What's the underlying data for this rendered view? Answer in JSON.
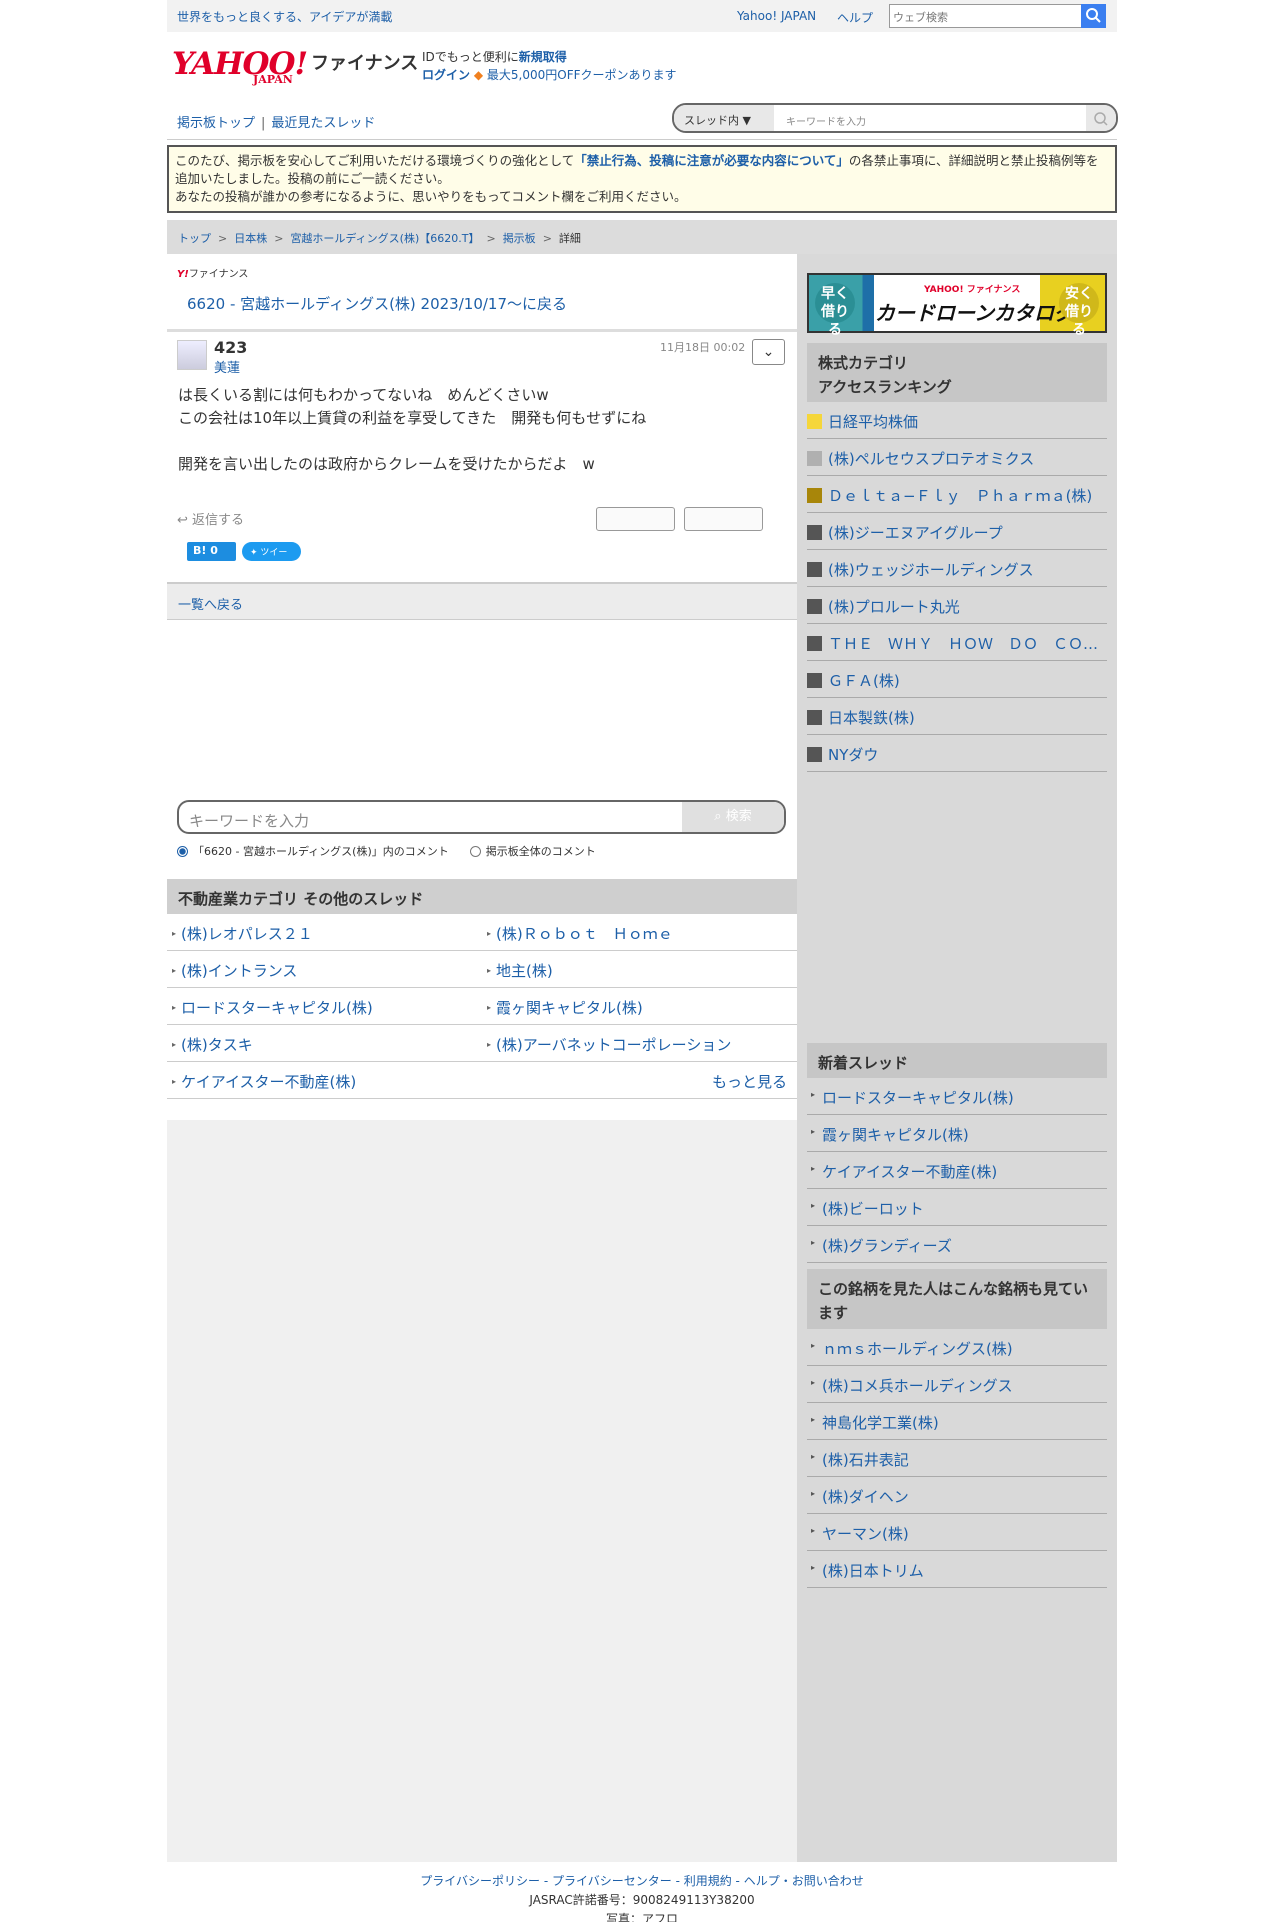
{
  "topbar": {
    "tagline": "世界をもっと良くする、アイデアが満載",
    "yahoo_japan": "Yahoo! JAPAN",
    "help": "ヘルプ",
    "search_placeholder": "ウェブ検索"
  },
  "header": {
    "logo": "YAHOO!",
    "logo_sub": "JAPAN",
    "product": "ファイナンス",
    "id_text": "IDでもっと便利に",
    "signup": "新規取得",
    "login": "ログイン",
    "coupon": "最大5,000円OFFクーポンあります"
  },
  "board_nav": {
    "top": "掲示板トップ",
    "sep": "|",
    "recent": "最近見たスレッド",
    "scope": "スレッド内",
    "search_placeholder": "キーワードを入力"
  },
  "notice": {
    "line1_pre": "このたび、掲示板を安心してご利用いただける環境づくりの強化として",
    "line1_link": "「禁止行為、投稿に注意が必要な内容について」",
    "line1_post": "の各禁止事項に、詳細説明と禁止投稿例等を追加いたしました。投稿の前にご一読ください。",
    "line2": "あなたの投稿が誰かの参考になるように、思いやりをもってコメント欄をご利用ください。"
  },
  "breadcrumb": [
    "トップ",
    "日本株",
    "宮越ホールディングス(株)【6620.T】",
    "掲示板",
    "詳細"
  ],
  "post": {
    "brand_small": "ファイナンス",
    "back_thread": "6620 - 宮越ホールディングス(株) 2023/10/17〜に戻る",
    "number": "423",
    "author": "美蓮",
    "date": "11月18日 00:02",
    "menu_icon": "chevron-down-icon",
    "body": "​​は長くいる割には何もわかってないね　めんどくさいw\nこの会社は10年以上賃貸の利益を享受してきた　開発も何もせずにね\n\n開発を言い出したのは政府からクレームを受けたからだよ　w",
    "reply": "返信する",
    "hatena": "B! 0",
    "tweet": "ツイート"
  },
  "back_list": "一覧へ戻る",
  "keyword_search": {
    "placeholder": "キーワードを入力",
    "button": "検索",
    "option_thread": "「6620 - 宮越ホールディングス(株)」内のコメント",
    "option_all": "掲示板全体のコメント"
  },
  "other_threads": {
    "title": "不動産業カテゴリ  その他のスレッド",
    "items": [
      [
        "(株)レオパレス２１",
        "(株)Ｒｏｂｏｔ　Ｈｏｍｅ"
      ],
      [
        "(株)イントランス",
        "地主(株)"
      ],
      [
        "ロードスターキャピタル(株)",
        "霞ヶ関キャピタル(株)"
      ],
      [
        "(株)タスキ",
        "(株)アーバネットコーポレーション"
      ]
    ],
    "last": "ケイアイスター不動産(株)",
    "more": "もっと見る"
  },
  "banner": {
    "left": "早く借りる",
    "right": "安く借りる",
    "text": "カードローンカタログ",
    "brand": "YAHOO! ファイナンス"
  },
  "ranking": {
    "title_line1": "株式カテゴリ",
    "title_line2": "アクセスランキング",
    "items": [
      {
        "label": "日経平均株価",
        "color": "#f5d63a"
      },
      {
        "label": "(株)ペルセウスプロテオミクス",
        "color": "#b0b0b0"
      },
      {
        "label": "Ｄｅｌｔａ−Ｆｌｙ　Ｐｈａｒｍａ(株)",
        "color": "#a8860a"
      },
      {
        "label": "(株)ジーエヌアイグループ",
        "color": "#555555"
      },
      {
        "label": "(株)ウェッジホールディングス",
        "color": "#555555"
      },
      {
        "label": "(株)プロルート丸光",
        "color": "#555555"
      },
      {
        "label": "ＴＨＥ　ＷＨＹ　ＨＯＷ　ＤＯ　ＣＯＭＰＡＮＹ(株)",
        "color": "#555555"
      },
      {
        "label": "ＧＦＡ(株)",
        "color": "#555555"
      },
      {
        "label": "日本製鉄(株)",
        "color": "#555555"
      },
      {
        "label": "NYダウ",
        "color": "#555555"
      }
    ]
  },
  "new_threads": {
    "title": "新着スレッド",
    "items": [
      "ロードスターキャピタル(株)",
      "霞ヶ関キャピタル(株)",
      "ケイアイスター不動産(株)",
      "(株)ビーロット",
      "(株)グランディーズ"
    ]
  },
  "also_viewed": {
    "title": "この銘柄を見た人はこんな銘柄も見ています",
    "items": [
      "ｎｍｓホールディングス(株)",
      "(株)コメ兵ホールディングス",
      "神島化学工業(株)",
      "(株)石井表記",
      "(株)ダイヘン",
      "ヤーマン(株)",
      "(株)日本トリム"
    ]
  },
  "footer": {
    "links": "プライバシーポリシー - プライバシーセンター - 利用規約 - ヘルプ・お問い合わせ",
    "jasrac": "JASRAC許諾番号：9008249113Y38200",
    "photo": "写真：アフロ"
  }
}
